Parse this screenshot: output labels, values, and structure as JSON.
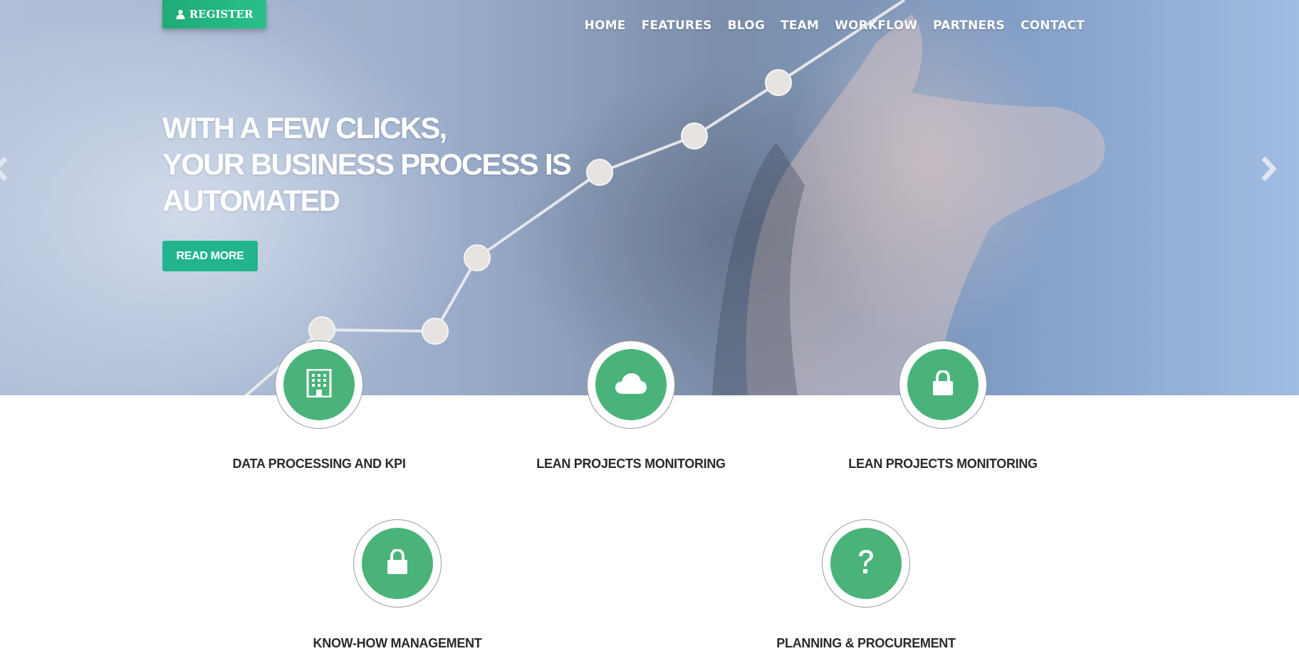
{
  "header": {
    "register_label": "REGISTER",
    "nav": [
      "HOME",
      "FEATURES",
      "BLOG",
      "TEAM",
      "WORKFLOW",
      "PARTNERS",
      "CONTACT"
    ]
  },
  "hero": {
    "headline_lines": [
      "WITH A FEW CLICKS,",
      "YOUR BUSINESS PROCESS IS",
      "AUTOMATED"
    ],
    "read_more_label": "READ MORE",
    "prev_icon": "chevron-left-icon",
    "next_icon": "chevron-right-icon"
  },
  "features": [
    {
      "title": "DATA PROCESSING AND KPI",
      "icon": "building-icon"
    },
    {
      "title": "LEAN PROJECTS MONITORING",
      "icon": "cloud-icon"
    },
    {
      "title": "LEAN PROJECTS MONITORING",
      "icon": "lock-icon"
    },
    {
      "title": "KNOW-HOW MANAGEMENT",
      "icon": "lock-icon"
    },
    {
      "title": "PLANNING & PROCUREMENT",
      "icon": "question-icon"
    }
  ],
  "colors": {
    "accent_green": "#4ab37a",
    "button_green": "#22b48c",
    "text_dark": "#2a2a2a"
  }
}
